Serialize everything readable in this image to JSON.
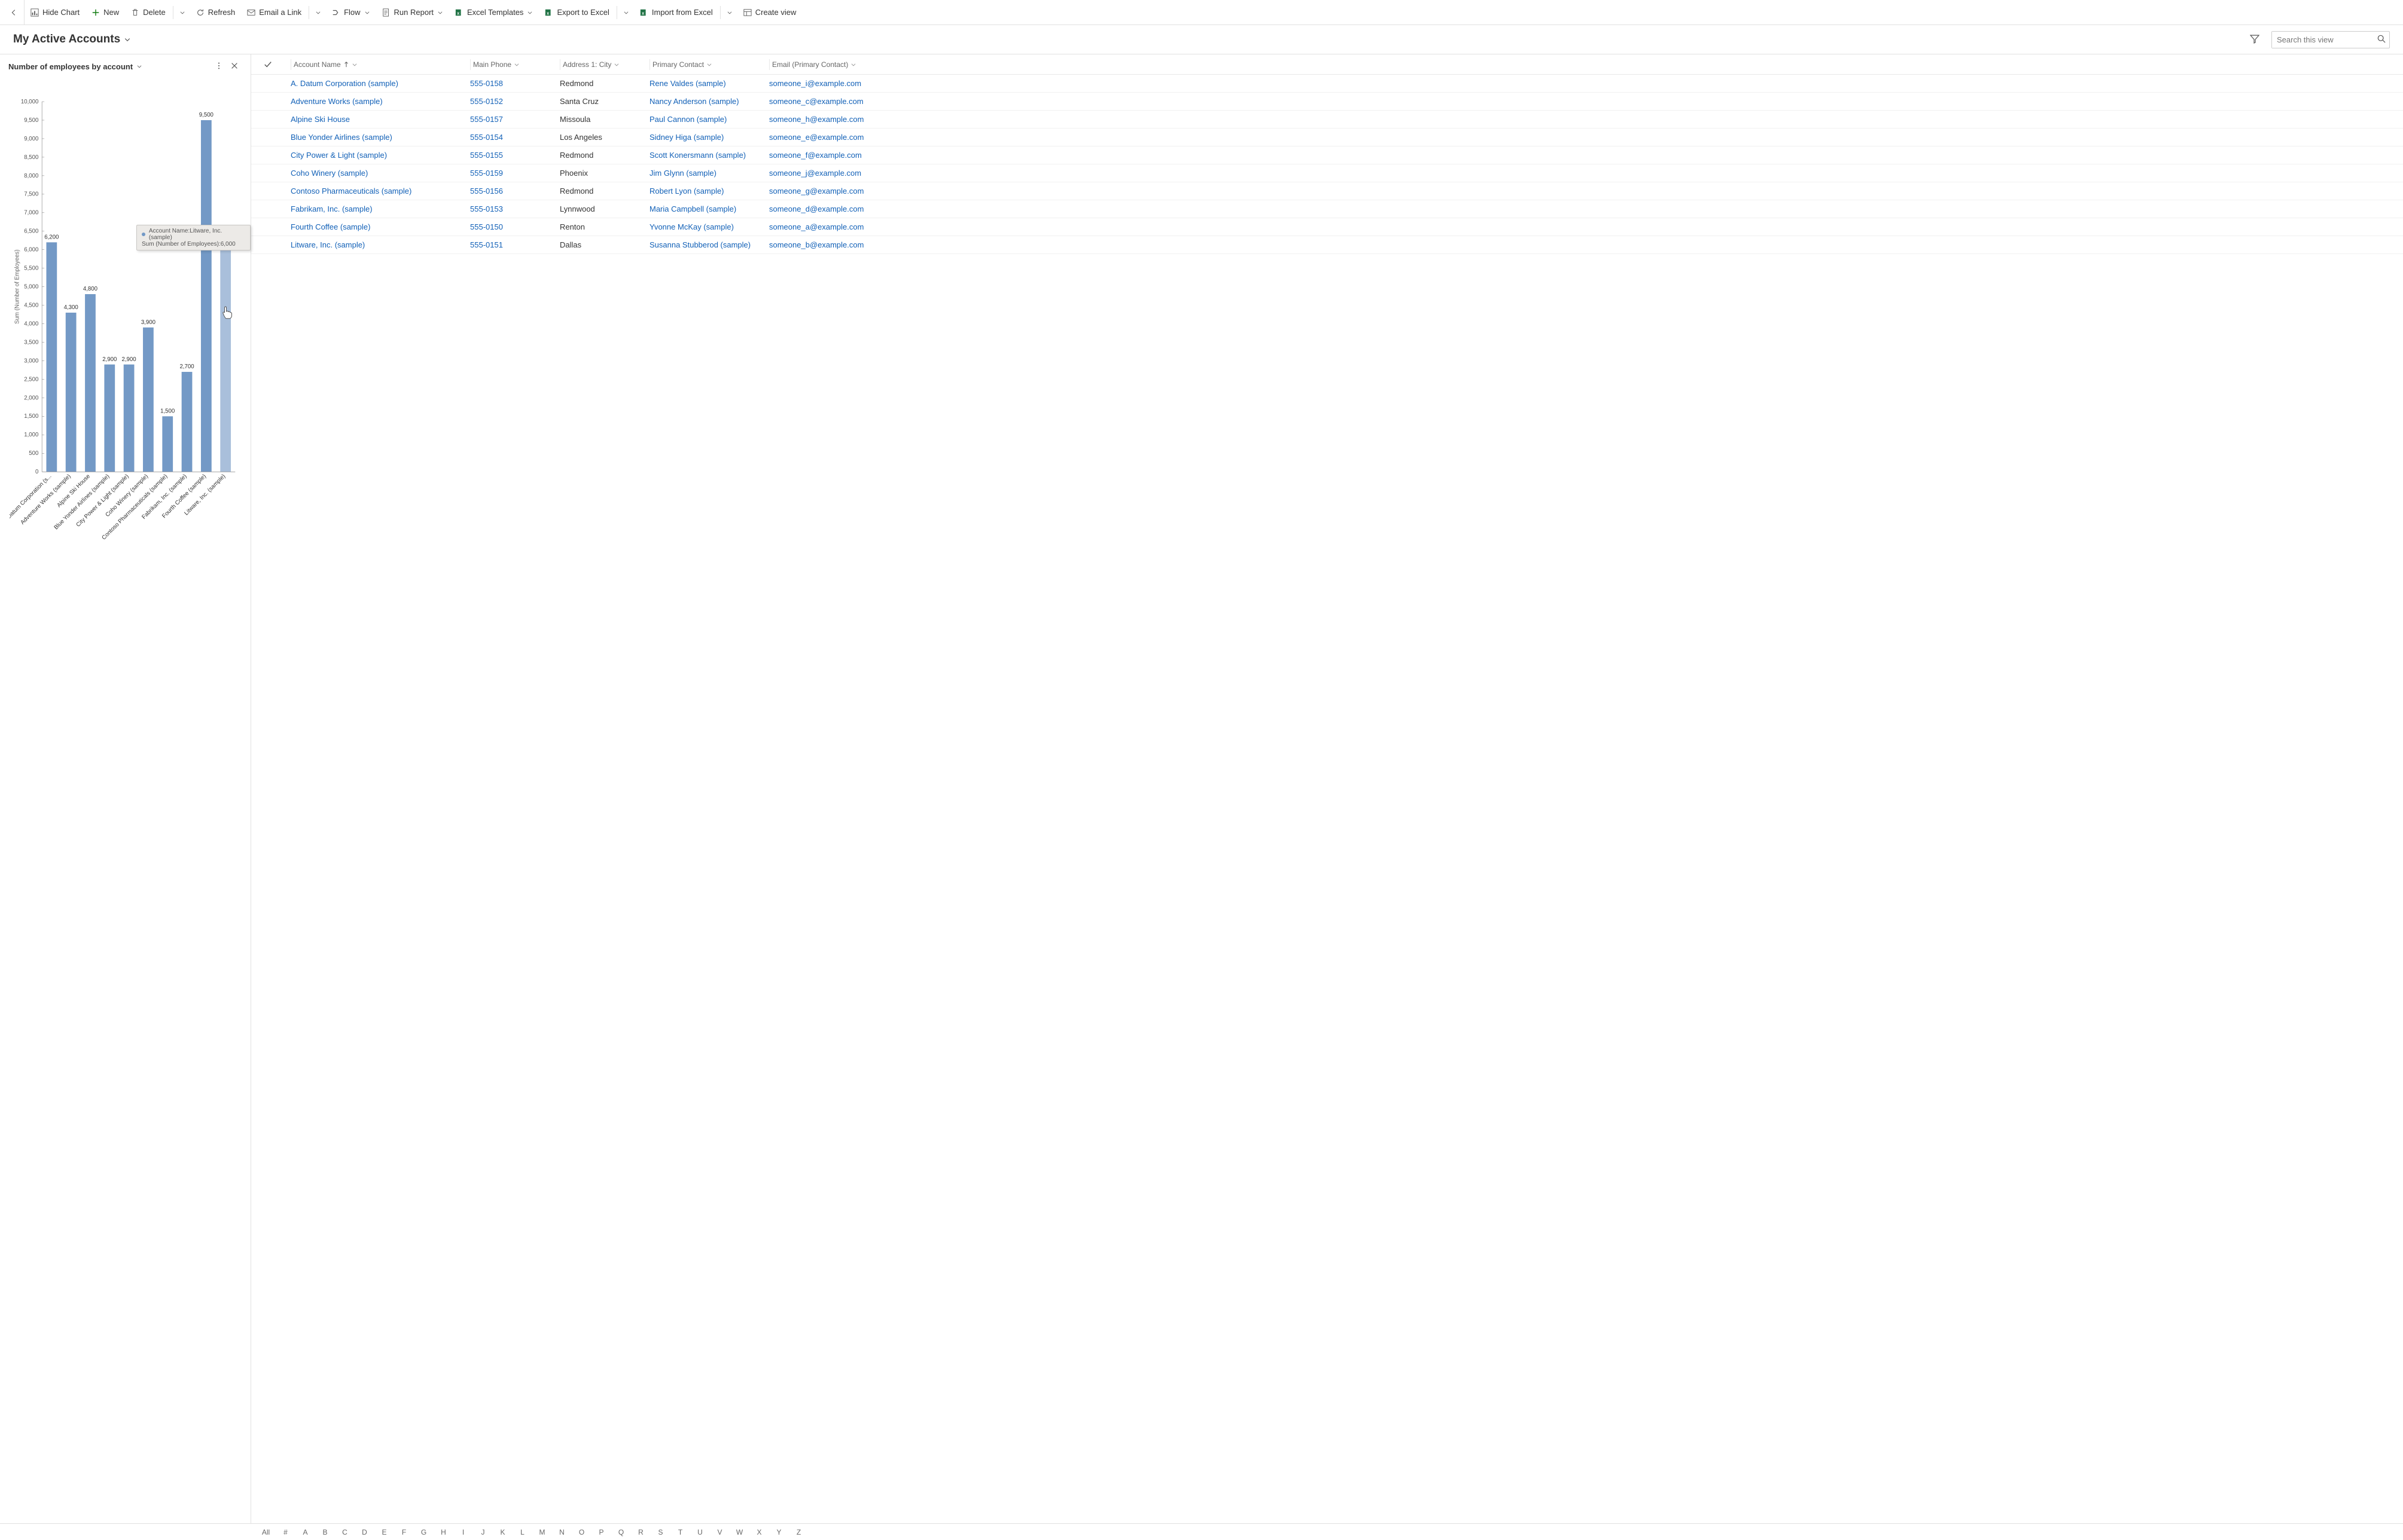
{
  "toolbar": {
    "hide_chart": "Hide Chart",
    "new": "New",
    "delete": "Delete",
    "refresh": "Refresh",
    "email_link": "Email a Link",
    "flow": "Flow",
    "run_report": "Run Report",
    "excel_templates": "Excel Templates",
    "export_excel": "Export to Excel",
    "import_excel": "Import from Excel",
    "create_view": "Create view"
  },
  "view": {
    "title": "My Active Accounts",
    "search_placeholder": "Search this view"
  },
  "chart": {
    "title": "Number of employees by account",
    "ylabel": "Sum (Number of Employees)",
    "tooltip_line1": "Account Name:Litware, Inc. (sample)",
    "tooltip_line2": "Sum (Number of Employees):6,000"
  },
  "chart_data": {
    "type": "bar",
    "title": "Number of employees by account",
    "xlabel": "",
    "ylabel": "Sum (Number of Employees)",
    "ylim": [
      0,
      10000
    ],
    "ytick_step": 500,
    "categories": [
      "A. Datum Corporation (s...",
      "Adventure Works (sample)",
      "Alpine Ski House",
      "Blue Yonder Airlines (sample)",
      "City Power & Light (sample)",
      "Coho Winery (sample)",
      "Contoso Pharmaceuticals (sample)",
      "Fabrikam, Inc. (sample)",
      "Fourth Coffee (sample)",
      "Litware, Inc. (sample)"
    ],
    "values": [
      6200,
      4300,
      4800,
      2900,
      2900,
      3900,
      1500,
      2700,
      9500,
      6000
    ],
    "value_labels": [
      "6,200",
      "4,300",
      "4,800",
      "2,900",
      "2,900",
      "3,900",
      "1,500",
      "2,700",
      "9,500",
      "6,000"
    ],
    "highlighted_index": 9
  },
  "grid": {
    "columns": {
      "account": "Account Name",
      "phone": "Main Phone",
      "city": "Address 1: City",
      "contact": "Primary Contact",
      "email": "Email (Primary Contact)"
    },
    "rows": [
      {
        "account": "A. Datum Corporation (sample)",
        "phone": "555-0158",
        "city": "Redmond",
        "contact": "Rene Valdes (sample)",
        "email": "someone_i@example.com"
      },
      {
        "account": "Adventure Works (sample)",
        "phone": "555-0152",
        "city": "Santa Cruz",
        "contact": "Nancy Anderson (sample)",
        "email": "someone_c@example.com"
      },
      {
        "account": "Alpine Ski House",
        "phone": "555-0157",
        "city": "Missoula",
        "contact": "Paul Cannon (sample)",
        "email": "someone_h@example.com"
      },
      {
        "account": "Blue Yonder Airlines (sample)",
        "phone": "555-0154",
        "city": "Los Angeles",
        "contact": "Sidney Higa (sample)",
        "email": "someone_e@example.com"
      },
      {
        "account": "City Power & Light (sample)",
        "phone": "555-0155",
        "city": "Redmond",
        "contact": "Scott Konersmann (sample)",
        "email": "someone_f@example.com"
      },
      {
        "account": "Coho Winery (sample)",
        "phone": "555-0159",
        "city": "Phoenix",
        "contact": "Jim Glynn (sample)",
        "email": "someone_j@example.com"
      },
      {
        "account": "Contoso Pharmaceuticals (sample)",
        "phone": "555-0156",
        "city": "Redmond",
        "contact": "Robert Lyon (sample)",
        "email": "someone_g@example.com"
      },
      {
        "account": "Fabrikam, Inc. (sample)",
        "phone": "555-0153",
        "city": "Lynnwood",
        "contact": "Maria Campbell (sample)",
        "email": "someone_d@example.com"
      },
      {
        "account": "Fourth Coffee (sample)",
        "phone": "555-0150",
        "city": "Renton",
        "contact": "Yvonne McKay (sample)",
        "email": "someone_a@example.com"
      },
      {
        "account": "Litware, Inc. (sample)",
        "phone": "555-0151",
        "city": "Dallas",
        "contact": "Susanna Stubberod (sample)",
        "email": "someone_b@example.com"
      }
    ]
  },
  "letter_bar": [
    "All",
    "#",
    "A",
    "B",
    "C",
    "D",
    "E",
    "F",
    "G",
    "H",
    "I",
    "J",
    "K",
    "L",
    "M",
    "N",
    "O",
    "P",
    "Q",
    "R",
    "S",
    "T",
    "U",
    "V",
    "W",
    "X",
    "Y",
    "Z"
  ],
  "colors": {
    "bar": "#7399c6",
    "link": "#1160b7"
  }
}
